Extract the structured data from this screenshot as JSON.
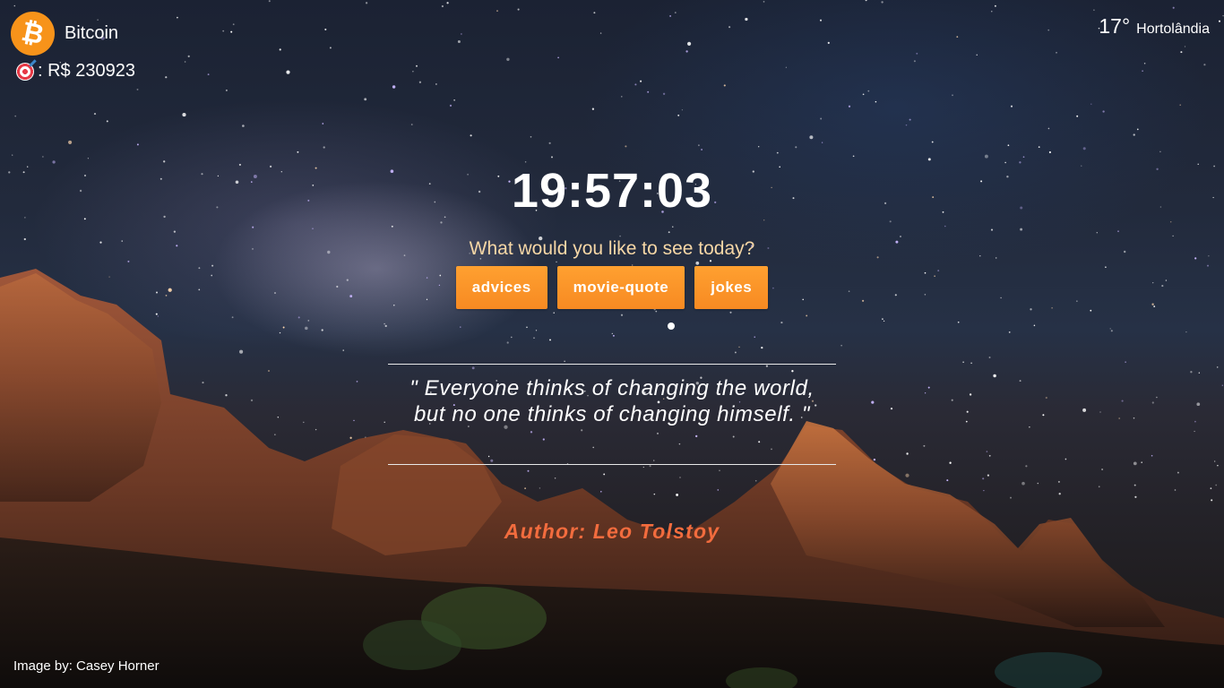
{
  "crypto": {
    "name": "Bitcoin",
    "logo_glyph": "₿",
    "logo_icon": "bitcoin-icon",
    "price_icon": "target-icon",
    "price_text": ": R$ 230923",
    "accent": "#f7931a"
  },
  "weather": {
    "temperature": "17°",
    "city": "Hortolândia"
  },
  "clock": {
    "time": "19:57:03"
  },
  "prompt": {
    "text": "What would you like to see today?"
  },
  "buttons": [
    {
      "label": "advices"
    },
    {
      "label": "movie-quote"
    },
    {
      "label": "jokes"
    }
  ],
  "quote": {
    "text": "\" Everyone thinks of changing the world, but no one thinks of changing himself. \"",
    "author": "Author: Leo Tolstoy"
  },
  "credit": {
    "text": "Image by: Casey Horner"
  },
  "colors": {
    "button": "#f78a22",
    "author": "#f26c3e",
    "prompt": "#f6d7a6"
  }
}
